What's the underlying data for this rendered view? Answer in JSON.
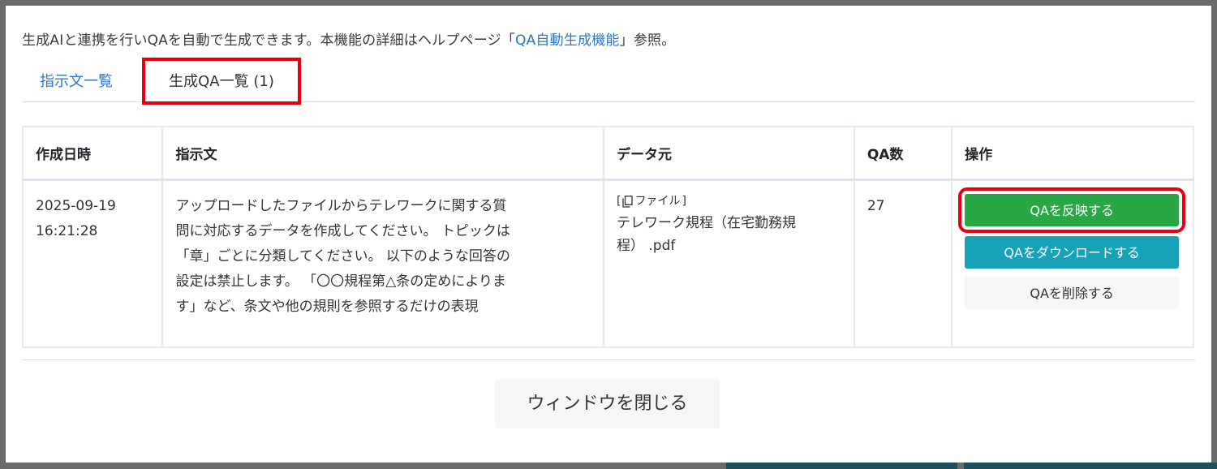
{
  "intro": {
    "text_before": "生成AIと連携を行いQAを自動で生成できます。本機能の詳細はヘルプページ「",
    "link": "QA自動生成機能",
    "text_after": "」参照。"
  },
  "tabs": [
    {
      "label": "指示文一覧",
      "active": false
    },
    {
      "label": "生成QA一覧 (1)",
      "active": true
    }
  ],
  "table": {
    "headers": [
      "作成日時",
      "指示文",
      "データ元",
      "QA数",
      "操作"
    ],
    "rows": [
      {
        "date": "2025-09-19",
        "time": "16:21:28",
        "prompt_lines": [
          "アップロードしたファイルからテレワークに関する質",
          "問に対応するデータを作成してください。 トピックは",
          "「章」ごとに分類してください。 以下のような回答の",
          "設定は禁止します。 「〇〇規程第△条の定めによりま",
          "す」など、条文や他の規則を参照するだけの表現"
        ],
        "source_label": "ファイル",
        "source_name_lines": [
          "テレワーク規程（在宅勤務規",
          "程） .pdf"
        ],
        "qa_count": "27",
        "actions": {
          "reflect": "QAを反映する",
          "download": "QAをダウンロードする",
          "delete": "QAを削除する"
        }
      }
    ]
  },
  "footer": {
    "close_label": "ウィンドウを閉じる"
  },
  "colors": {
    "reflect": "#28a745",
    "download": "#17a2b8",
    "highlight": "#e60012",
    "link": "#2e78c7"
  }
}
